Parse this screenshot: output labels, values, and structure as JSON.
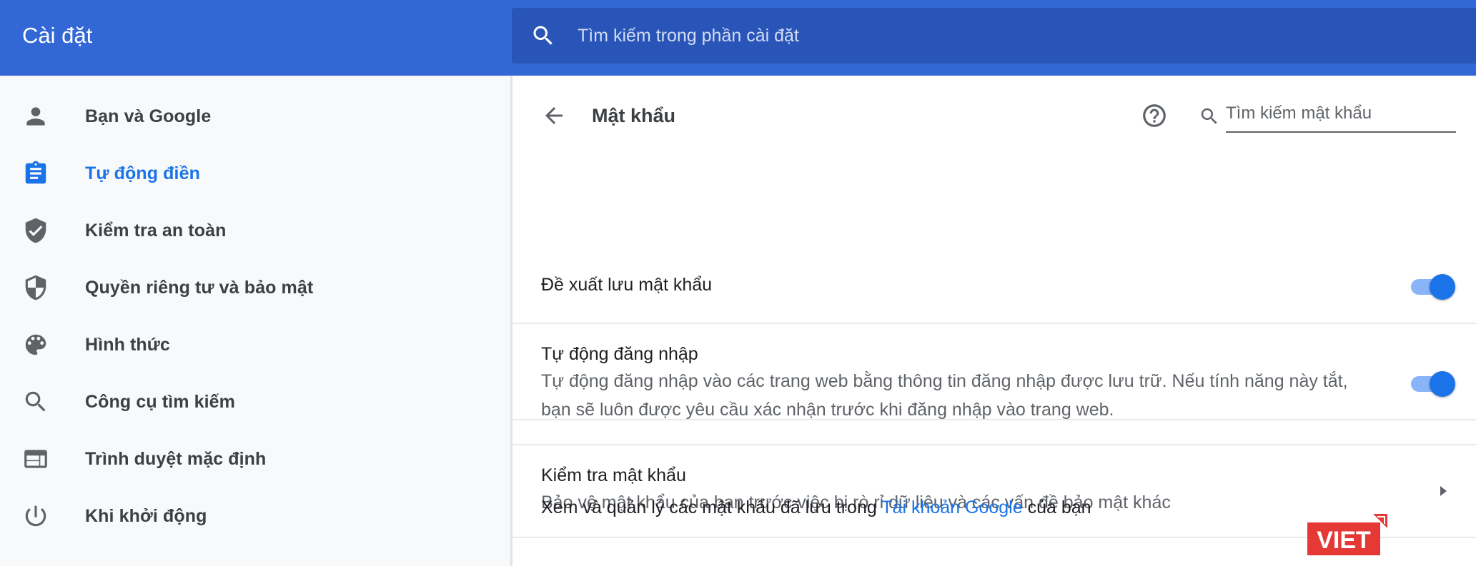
{
  "header": {
    "title": "Cài đặt",
    "search_placeholder": "Tìm kiếm trong phần cài đặt"
  },
  "sidebar": {
    "items": [
      {
        "label": "Bạn và Google",
        "icon": "person-icon",
        "active": false
      },
      {
        "label": "Tự động điền",
        "icon": "clipboard-icon",
        "active": true
      },
      {
        "label": "Kiểm tra an toàn",
        "icon": "shield-check-icon",
        "active": false
      },
      {
        "label": "Quyền riêng tư và bảo mật",
        "icon": "shield-icon",
        "active": false
      },
      {
        "label": "Hình thức",
        "icon": "palette-icon",
        "active": false
      },
      {
        "label": "Công cụ tìm kiếm",
        "icon": "search-icon",
        "active": false
      },
      {
        "label": "Trình duyệt mặc định",
        "icon": "browser-icon",
        "active": false
      },
      {
        "label": "Khi khởi động",
        "icon": "power-icon",
        "active": false
      }
    ]
  },
  "main": {
    "title": "Mật khẩu",
    "password_search_placeholder": "Tìm kiếm mật khẩu",
    "offer_save": {
      "title": "Đề xuất lưu mật khẩu",
      "enabled": true
    },
    "auto_signin": {
      "title": "Tự động đăng nhập",
      "desc_line1": "Tự động đăng nhập vào các trang web bằng thông tin đăng nhập được lưu trữ. Nếu tính năng này tắt,",
      "desc_line2": "bạn sẽ luôn được yêu cầu xác nhận trước khi đăng nhập vào trang web.",
      "enabled": true
    },
    "check_passwords": {
      "title": "Kiểm tra mật khẩu",
      "desc": "Bảo vệ mật khẩu của bạn trước việc bị rò rỉ dữ liệu và các vấn đề bảo mật khác"
    },
    "manage": {
      "prefix": "Xem và quản lý các mật khẩu đã lưu trong ",
      "link": "Tài khoản Google",
      "suffix": " của bạn"
    }
  },
  "watermark": {
    "text": "VIET",
    "color": "#e53935"
  },
  "colors": {
    "header": "#3367d6",
    "search_bar": "#2a55b8",
    "accent": "#1a73e8",
    "toggle_track": "#8ab4f8"
  }
}
